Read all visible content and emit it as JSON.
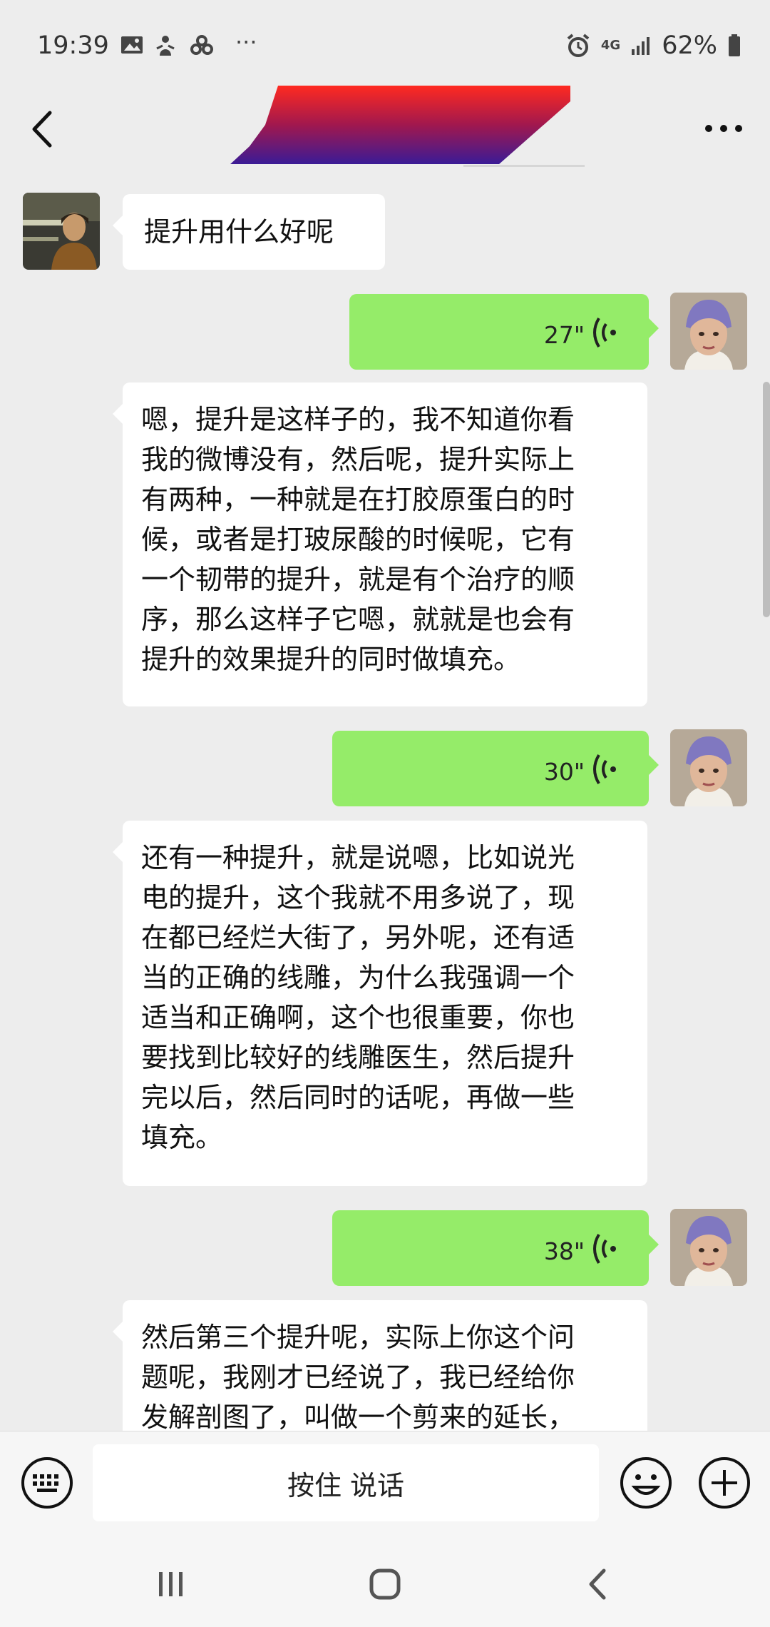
{
  "status_bar": {
    "time": "19:39",
    "more_glyph": "···",
    "network": "4G",
    "battery": "62%",
    "icons": [
      "image-icon",
      "app-notification-icon",
      "app-notification-icon-2",
      "alarm-icon",
      "signal-icon",
      "battery-icon"
    ]
  },
  "header": {
    "back_icon": "chevron-left-icon",
    "more_icon": "more-dots-icon",
    "title_redacted": true
  },
  "messages": [
    {
      "side": "left",
      "type": "text",
      "text": "提升用什么好呢"
    },
    {
      "side": "right",
      "type": "voice",
      "duration": "27\""
    },
    {
      "side": "left",
      "type": "text",
      "lines": [
        "嗯，提升是这样子的，我不知道你看",
        "我的微博没有，然后呢，提升实际上",
        "有两种，一种就是在打胶原蛋白的时",
        "候，或者是打玻尿酸的时候呢，它有",
        "一个韧带的提升，就是有个治疗的顺",
        "序，那么这样子它嗯，就就是也会有",
        "提升的效果提升的同时做填充。"
      ]
    },
    {
      "side": "right",
      "type": "voice",
      "duration": "30\""
    },
    {
      "side": "left",
      "type": "text",
      "lines": [
        "还有一种提升，就是说嗯，比如说光",
        "电的提升，这个我就不用多说了，现",
        "在都已经烂大街了，另外呢，还有适",
        "当的正确的线雕，为什么我强调一个",
        "适当和正确啊，这个也很重要，你也",
        "要找到比较好的线雕医生，然后提升",
        "完以后，然后同时的话呢，再做一些",
        "填充。"
      ]
    },
    {
      "side": "right",
      "type": "voice",
      "duration": "38\""
    },
    {
      "side": "left",
      "type": "text",
      "lines": [
        "然后第三个提升呢，实际上你这个问",
        "题呢，我刚才已经说了，我已经给你",
        "发解剖图了，叫做一个剪来的延长，"
      ]
    }
  ],
  "input_bar": {
    "keyboard_icon": "keyboard-icon",
    "hold_to_talk_label": "按住 说话",
    "emoji_icon": "emoji-icon",
    "plus_icon": "plus-icon"
  },
  "nav_bar": {
    "icons": [
      "recent-apps-icon",
      "home-icon",
      "back-icon"
    ]
  },
  "colors": {
    "background": "#ededed",
    "incoming_bubble": "#ffffff",
    "outgoing_bubble": "#95ec69"
  }
}
